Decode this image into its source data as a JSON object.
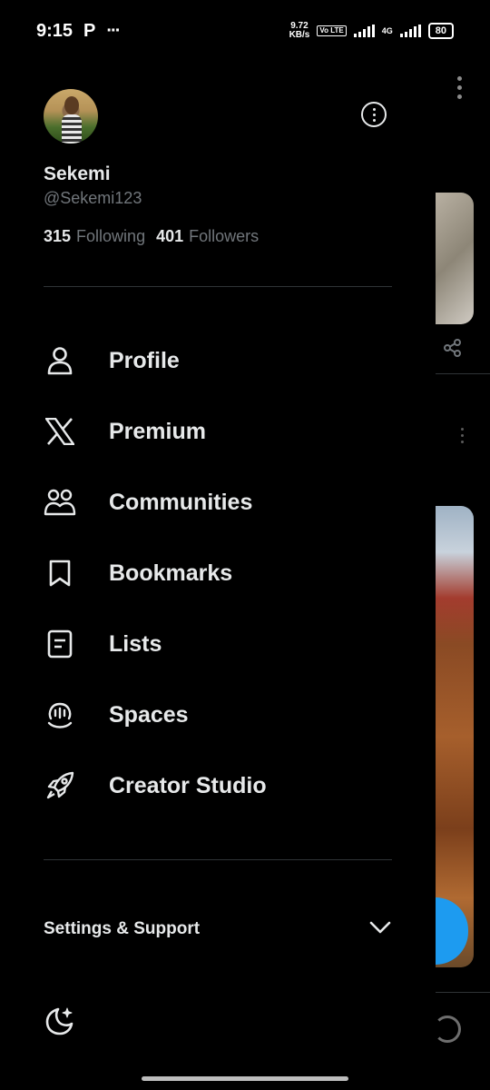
{
  "status_bar": {
    "time": "9:15",
    "app_letter": "P",
    "more": "···",
    "speed_value": "9.72",
    "speed_unit": "KB/s",
    "volte": "Vo LTE",
    "network": "4G",
    "battery": "80"
  },
  "profile": {
    "display_name": "Sekemi",
    "handle": "@Sekemi123",
    "following_count": "315",
    "following_label": "Following",
    "followers_count": "401",
    "followers_label": "Followers"
  },
  "menu": {
    "items": [
      {
        "label": "Profile",
        "icon": "person-icon"
      },
      {
        "label": "Premium",
        "icon": "x-logo-icon"
      },
      {
        "label": "Communities",
        "icon": "communities-icon"
      },
      {
        "label": "Bookmarks",
        "icon": "bookmark-icon"
      },
      {
        "label": "Lists",
        "icon": "list-icon"
      },
      {
        "label": "Spaces",
        "icon": "spaces-icon"
      },
      {
        "label": "Creator Studio",
        "icon": "rocket-icon"
      }
    ]
  },
  "settings": {
    "label": "Settings & Support"
  },
  "colors": {
    "background": "#000000",
    "text_primary": "#e7e9ea",
    "text_secondary": "#71767b",
    "divider": "#2f3336",
    "accent": "#1d9bf0"
  }
}
